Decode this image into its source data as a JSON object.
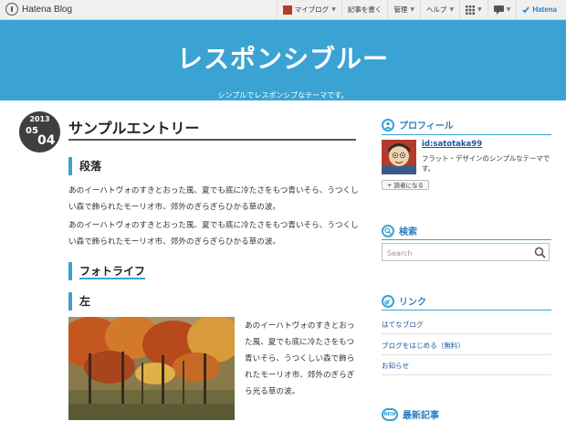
{
  "navbar": {
    "logo": "Hatena Blog",
    "my_blog": "マイブログ",
    "write": "記事を書く",
    "manage": "管理",
    "help": "ヘルプ",
    "brand": "Hatena"
  },
  "header": {
    "title": "レスポンシブルー",
    "subtitle": "シンプルでレスポンシブなテーマです。"
  },
  "entry": {
    "date": {
      "year": "2013",
      "month": "05",
      "day": "04"
    },
    "title": "サンプルエントリー",
    "sections": [
      {
        "heading": "段落"
      },
      {
        "heading": "フォトライフ"
      },
      {
        "heading": "左"
      }
    ],
    "paragraph1": "あのイーハトヴォのすきとおった風、夏でも底に冷たさをもつ青いそら、うつくしい森で飾られたモーリオ市、郊外のぎらぎらひかる草の波。",
    "paragraph2": "あのイーハトヴォのすきとおった風、夏でも底に冷たさをもつ青いそら、うつくしい森で飾られたモーリオ市、郊外のぎらぎらひかる草の波。",
    "photo_text": "あのイーハトヴォのすきとおった風、夏でも底に冷たさをもつ青いそら、うつくしい森で飾られたモーリオ市、郊外のぎらぎら光る草の波。"
  },
  "sidebar": {
    "profile": {
      "heading": "プロフィール",
      "id": "id:satotaka99",
      "description": "フラット・デザインのシンプルなテーマです。",
      "reader_button": "読者になる"
    },
    "search": {
      "heading": "検索",
      "placeholder": "Search"
    },
    "links": {
      "heading": "リンク",
      "items": [
        "はてなブログ",
        "ブログをはじめる（無料）",
        "お知らせ"
      ]
    },
    "recent": {
      "heading": "最新記事"
    }
  },
  "colors": {
    "accent": "#3aa3d3",
    "link": "#1f56a0",
    "date_circle": "#3f3f3f"
  }
}
